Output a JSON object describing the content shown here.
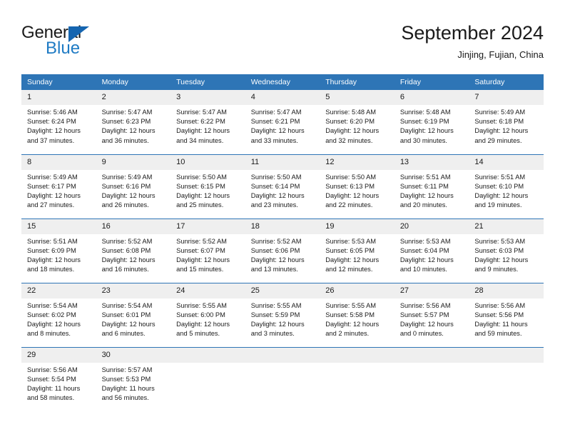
{
  "logo": {
    "word_one": "General",
    "word_two": "Blue",
    "triangle_icon": "triangle-icon",
    "brand_color": "#1f7bc4"
  },
  "header": {
    "title": "September 2024",
    "subtitle": "Jinjing, Fujian, China"
  },
  "calendar": {
    "header_color": "#2e75b6",
    "daynum_band_color": "#efefef",
    "weekdays": [
      "Sunday",
      "Monday",
      "Tuesday",
      "Wednesday",
      "Thursday",
      "Friday",
      "Saturday"
    ],
    "weeks": [
      [
        {
          "day": "1",
          "sunrise": "Sunrise: 5:46 AM",
          "sunset": "Sunset: 6:24 PM",
          "daylight_line1": "Daylight: 12 hours",
          "daylight_line2": "and 37 minutes."
        },
        {
          "day": "2",
          "sunrise": "Sunrise: 5:47 AM",
          "sunset": "Sunset: 6:23 PM",
          "daylight_line1": "Daylight: 12 hours",
          "daylight_line2": "and 36 minutes."
        },
        {
          "day": "3",
          "sunrise": "Sunrise: 5:47 AM",
          "sunset": "Sunset: 6:22 PM",
          "daylight_line1": "Daylight: 12 hours",
          "daylight_line2": "and 34 minutes."
        },
        {
          "day": "4",
          "sunrise": "Sunrise: 5:47 AM",
          "sunset": "Sunset: 6:21 PM",
          "daylight_line1": "Daylight: 12 hours",
          "daylight_line2": "and 33 minutes."
        },
        {
          "day": "5",
          "sunrise": "Sunrise: 5:48 AM",
          "sunset": "Sunset: 6:20 PM",
          "daylight_line1": "Daylight: 12 hours",
          "daylight_line2": "and 32 minutes."
        },
        {
          "day": "6",
          "sunrise": "Sunrise: 5:48 AM",
          "sunset": "Sunset: 6:19 PM",
          "daylight_line1": "Daylight: 12 hours",
          "daylight_line2": "and 30 minutes."
        },
        {
          "day": "7",
          "sunrise": "Sunrise: 5:49 AM",
          "sunset": "Sunset: 6:18 PM",
          "daylight_line1": "Daylight: 12 hours",
          "daylight_line2": "and 29 minutes."
        }
      ],
      [
        {
          "day": "8",
          "sunrise": "Sunrise: 5:49 AM",
          "sunset": "Sunset: 6:17 PM",
          "daylight_line1": "Daylight: 12 hours",
          "daylight_line2": "and 27 minutes."
        },
        {
          "day": "9",
          "sunrise": "Sunrise: 5:49 AM",
          "sunset": "Sunset: 6:16 PM",
          "daylight_line1": "Daylight: 12 hours",
          "daylight_line2": "and 26 minutes."
        },
        {
          "day": "10",
          "sunrise": "Sunrise: 5:50 AM",
          "sunset": "Sunset: 6:15 PM",
          "daylight_line1": "Daylight: 12 hours",
          "daylight_line2": "and 25 minutes."
        },
        {
          "day": "11",
          "sunrise": "Sunrise: 5:50 AM",
          "sunset": "Sunset: 6:14 PM",
          "daylight_line1": "Daylight: 12 hours",
          "daylight_line2": "and 23 minutes."
        },
        {
          "day": "12",
          "sunrise": "Sunrise: 5:50 AM",
          "sunset": "Sunset: 6:13 PM",
          "daylight_line1": "Daylight: 12 hours",
          "daylight_line2": "and 22 minutes."
        },
        {
          "day": "13",
          "sunrise": "Sunrise: 5:51 AM",
          "sunset": "Sunset: 6:11 PM",
          "daylight_line1": "Daylight: 12 hours",
          "daylight_line2": "and 20 minutes."
        },
        {
          "day": "14",
          "sunrise": "Sunrise: 5:51 AM",
          "sunset": "Sunset: 6:10 PM",
          "daylight_line1": "Daylight: 12 hours",
          "daylight_line2": "and 19 minutes."
        }
      ],
      [
        {
          "day": "15",
          "sunrise": "Sunrise: 5:51 AM",
          "sunset": "Sunset: 6:09 PM",
          "daylight_line1": "Daylight: 12 hours",
          "daylight_line2": "and 18 minutes."
        },
        {
          "day": "16",
          "sunrise": "Sunrise: 5:52 AM",
          "sunset": "Sunset: 6:08 PM",
          "daylight_line1": "Daylight: 12 hours",
          "daylight_line2": "and 16 minutes."
        },
        {
          "day": "17",
          "sunrise": "Sunrise: 5:52 AM",
          "sunset": "Sunset: 6:07 PM",
          "daylight_line1": "Daylight: 12 hours",
          "daylight_line2": "and 15 minutes."
        },
        {
          "day": "18",
          "sunrise": "Sunrise: 5:52 AM",
          "sunset": "Sunset: 6:06 PM",
          "daylight_line1": "Daylight: 12 hours",
          "daylight_line2": "and 13 minutes."
        },
        {
          "day": "19",
          "sunrise": "Sunrise: 5:53 AM",
          "sunset": "Sunset: 6:05 PM",
          "daylight_line1": "Daylight: 12 hours",
          "daylight_line2": "and 12 minutes."
        },
        {
          "day": "20",
          "sunrise": "Sunrise: 5:53 AM",
          "sunset": "Sunset: 6:04 PM",
          "daylight_line1": "Daylight: 12 hours",
          "daylight_line2": "and 10 minutes."
        },
        {
          "day": "21",
          "sunrise": "Sunrise: 5:53 AM",
          "sunset": "Sunset: 6:03 PM",
          "daylight_line1": "Daylight: 12 hours",
          "daylight_line2": "and 9 minutes."
        }
      ],
      [
        {
          "day": "22",
          "sunrise": "Sunrise: 5:54 AM",
          "sunset": "Sunset: 6:02 PM",
          "daylight_line1": "Daylight: 12 hours",
          "daylight_line2": "and 8 minutes."
        },
        {
          "day": "23",
          "sunrise": "Sunrise: 5:54 AM",
          "sunset": "Sunset: 6:01 PM",
          "daylight_line1": "Daylight: 12 hours",
          "daylight_line2": "and 6 minutes."
        },
        {
          "day": "24",
          "sunrise": "Sunrise: 5:55 AM",
          "sunset": "Sunset: 6:00 PM",
          "daylight_line1": "Daylight: 12 hours",
          "daylight_line2": "and 5 minutes."
        },
        {
          "day": "25",
          "sunrise": "Sunrise: 5:55 AM",
          "sunset": "Sunset: 5:59 PM",
          "daylight_line1": "Daylight: 12 hours",
          "daylight_line2": "and 3 minutes."
        },
        {
          "day": "26",
          "sunrise": "Sunrise: 5:55 AM",
          "sunset": "Sunset: 5:58 PM",
          "daylight_line1": "Daylight: 12 hours",
          "daylight_line2": "and 2 minutes."
        },
        {
          "day": "27",
          "sunrise": "Sunrise: 5:56 AM",
          "sunset": "Sunset: 5:57 PM",
          "daylight_line1": "Daylight: 12 hours",
          "daylight_line2": "and 0 minutes."
        },
        {
          "day": "28",
          "sunrise": "Sunrise: 5:56 AM",
          "sunset": "Sunset: 5:56 PM",
          "daylight_line1": "Daylight: 11 hours",
          "daylight_line2": "and 59 minutes."
        }
      ],
      [
        {
          "day": "29",
          "sunrise": "Sunrise: 5:56 AM",
          "sunset": "Sunset: 5:54 PM",
          "daylight_line1": "Daylight: 11 hours",
          "daylight_line2": "and 58 minutes."
        },
        {
          "day": "30",
          "sunrise": "Sunrise: 5:57 AM",
          "sunset": "Sunset: 5:53 PM",
          "daylight_line1": "Daylight: 11 hours",
          "daylight_line2": "and 56 minutes."
        },
        {
          "day": "",
          "sunrise": "",
          "sunset": "",
          "daylight_line1": "",
          "daylight_line2": ""
        },
        {
          "day": "",
          "sunrise": "",
          "sunset": "",
          "daylight_line1": "",
          "daylight_line2": ""
        },
        {
          "day": "",
          "sunrise": "",
          "sunset": "",
          "daylight_line1": "",
          "daylight_line2": ""
        },
        {
          "day": "",
          "sunrise": "",
          "sunset": "",
          "daylight_line1": "",
          "daylight_line2": ""
        },
        {
          "day": "",
          "sunrise": "",
          "sunset": "",
          "daylight_line1": "",
          "daylight_line2": ""
        }
      ]
    ]
  }
}
